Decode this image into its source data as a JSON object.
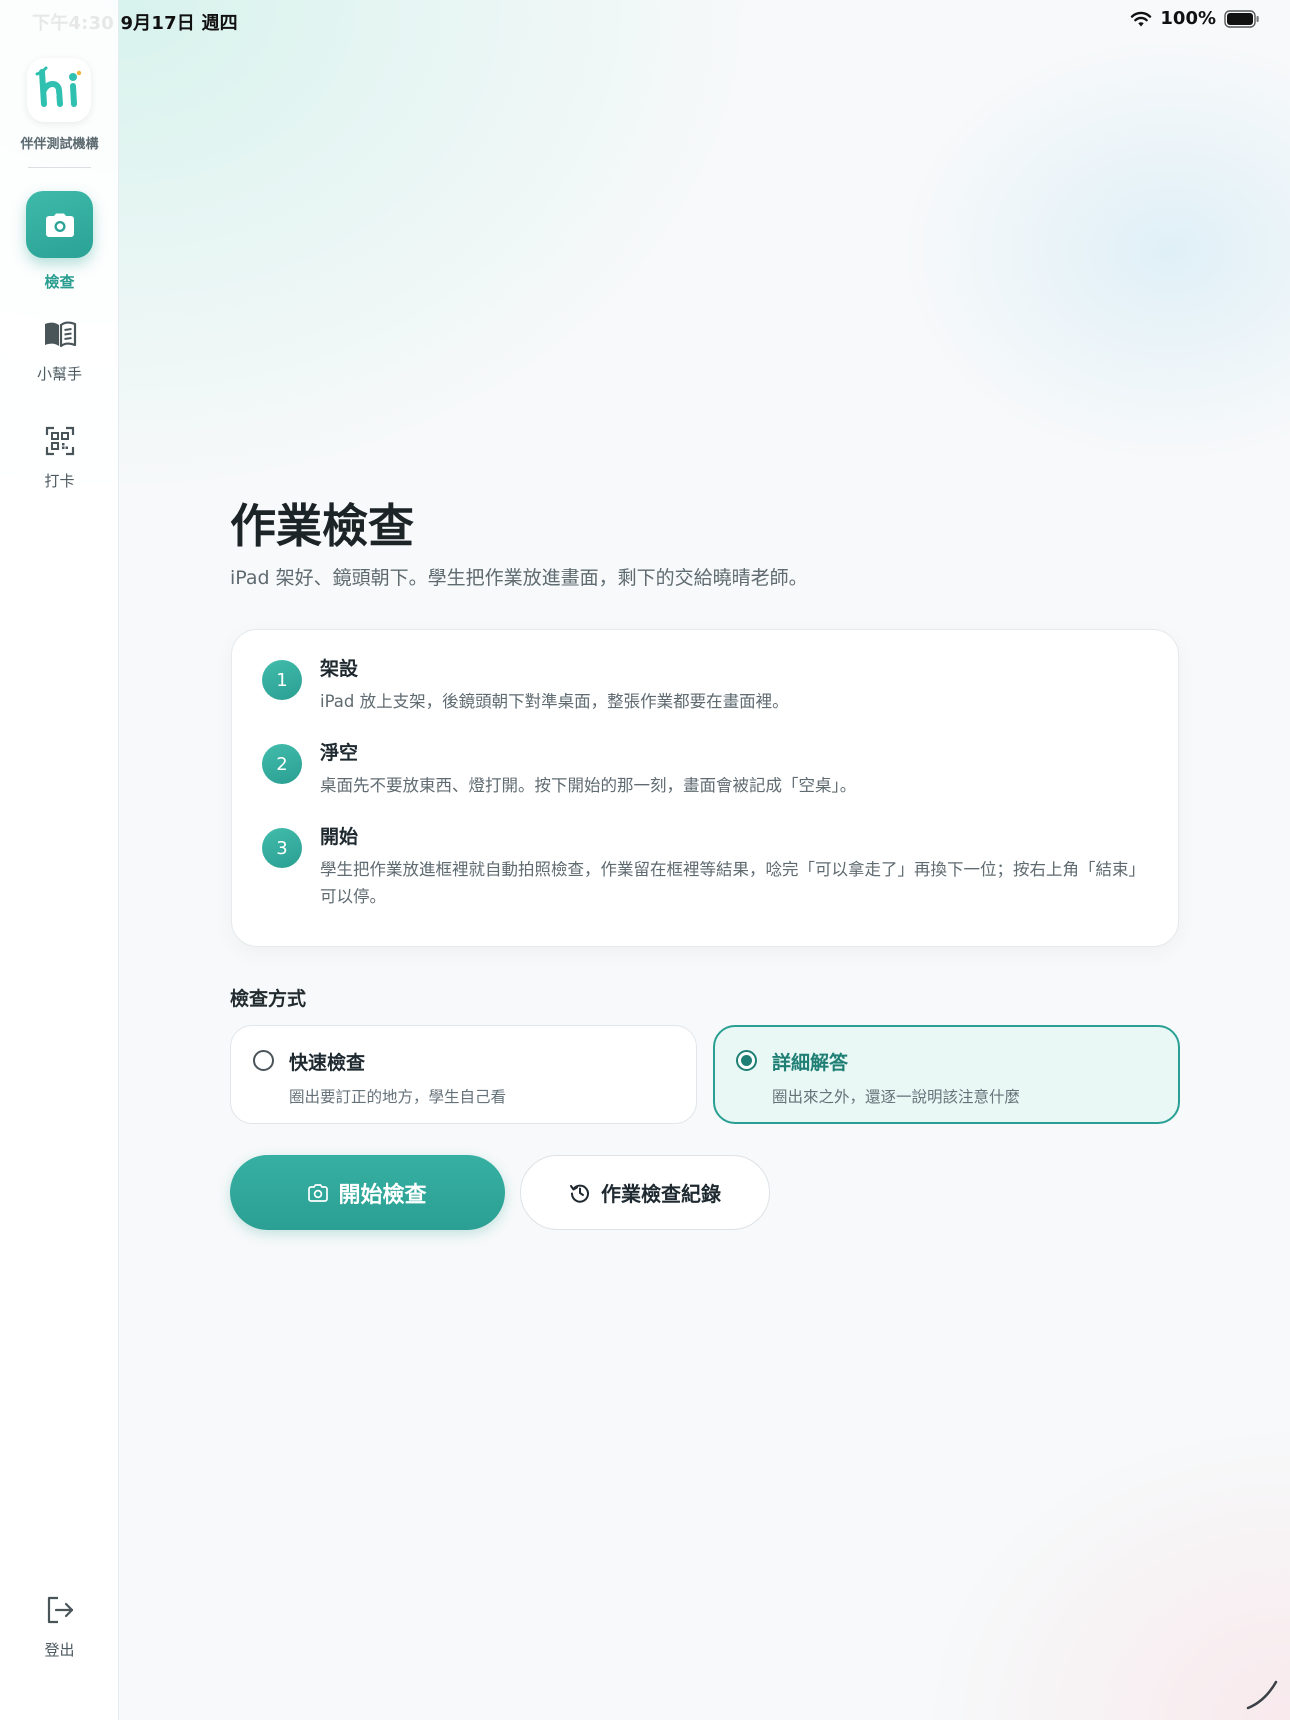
{
  "status_bar": {
    "time": "下午4:30  9月17日 週四",
    "battery_percent": "100%",
    "icons": [
      "wifi-icon",
      "battery-icon"
    ]
  },
  "sidebar": {
    "org_name": "伴伴測試機構",
    "logo_text": "hi",
    "items": [
      {
        "label": "檢查",
        "icon": "camera-icon",
        "active": true
      },
      {
        "label": "小幫手",
        "icon": "book-icon",
        "active": false
      },
      {
        "label": "打卡",
        "icon": "qr-code-icon",
        "active": false
      }
    ],
    "logout_label": "登出"
  },
  "main": {
    "title": "作業檢查",
    "subtitle": "iPad 架好、鏡頭朝下。學生把作業放進畫面，剩下的交給曉晴老師。",
    "steps": [
      {
        "num": "1",
        "title": "架設",
        "desc": "iPad 放上支架，後鏡頭朝下對準桌面，整張作業都要在畫面裡。"
      },
      {
        "num": "2",
        "title": "淨空",
        "desc": "桌面先不要放東西、燈打開。按下開始的那一刻，畫面會被記成「空桌」。"
      },
      {
        "num": "3",
        "title": "開始",
        "desc": "學生把作業放進框裡就自動拍照檢查，作業留在框裡等結果，唸完「可以拿走了」再換下一位；按右上角「結束」可以停。"
      }
    ],
    "method_heading": "檢查方式",
    "options": [
      {
        "title": "快速檢查",
        "desc": "圈出要訂正的地方，學生自己看",
        "selected": false
      },
      {
        "title": "詳細解答",
        "desc": "圈出來之外，還逐一說明該注意什麼",
        "selected": true
      }
    ],
    "start_button": "開始檢查",
    "history_button": "作業檢查紀錄"
  },
  "colors": {
    "accent": "#2a9f93",
    "accent_dark": "#1f7f75",
    "selected_bg": "#e9f8f5",
    "logo_teal": "#2fc0b0",
    "logo_dot": "#f2b43a"
  }
}
